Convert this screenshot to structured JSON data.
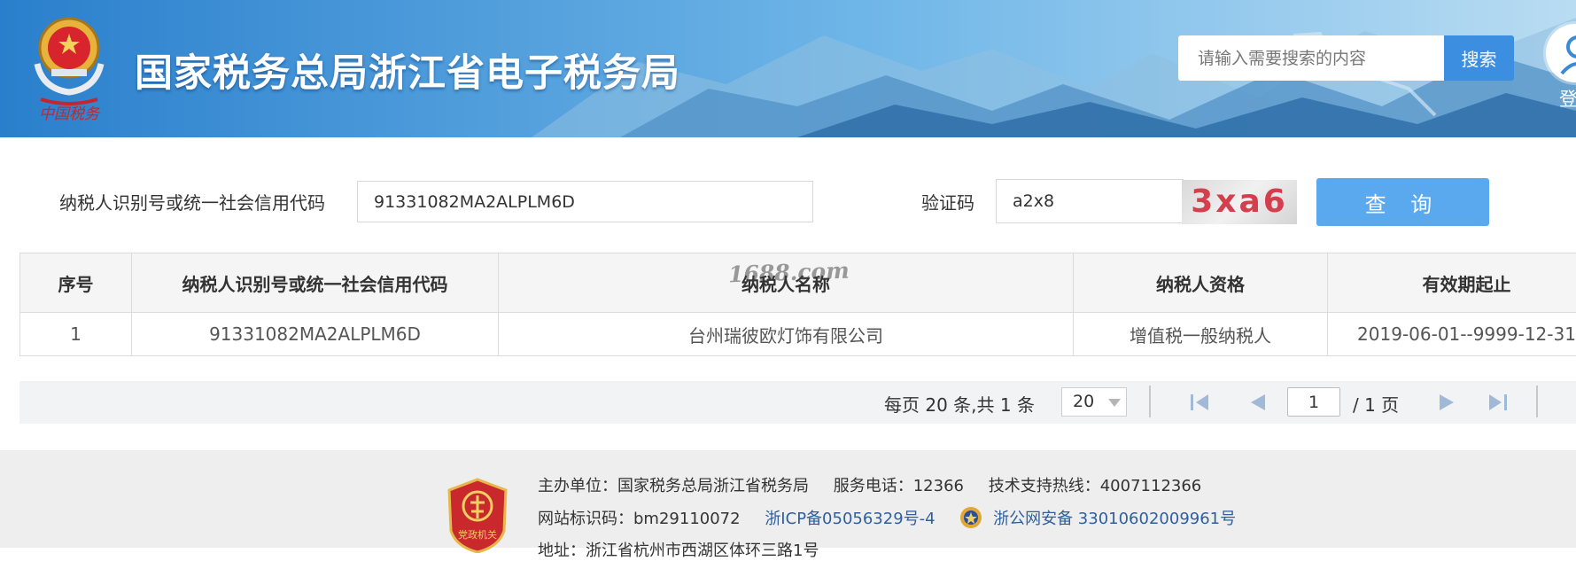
{
  "header": {
    "title": "国家税务总局浙江省电子税务局",
    "search_placeholder": "请输入需要搜索的内容",
    "search_button": "搜索",
    "login_label": "登",
    "emblem_text": "中国税务"
  },
  "query": {
    "taxpayer_id_label": "纳税人识别号或统一社会信用代码",
    "taxpayer_id_value": "91331082MA2ALPLM6D",
    "captcha_label": "验证码",
    "captcha_value": "a2x8",
    "captcha_image_text": "3xa6",
    "submit_button": "查 询"
  },
  "table": {
    "headers": [
      "序号",
      "纳税人识别号或统一社会信用代码",
      "纳税人名称",
      "纳税人资格",
      "有效期起止"
    ],
    "rows": [
      [
        "1",
        "91331082MA2ALPLM6D",
        "台州瑞彼欧灯饰有限公司",
        "增值税一般纳税人",
        "2019-06-01--9999-12-31"
      ]
    ],
    "watermark": "1688.com"
  },
  "pager": {
    "summary": "每页 20 条,共 1 条",
    "page_size": "20",
    "current_page": "1",
    "total_pages": "/ 1 页"
  },
  "footer": {
    "host": "主办单位：国家税务总局浙江省税务局",
    "phone": "服务电话：12366",
    "support": "技术支持热线：4007112366",
    "site_code": "网站标识码：bm29110072",
    "icp": "浙ICP备05056329号-4",
    "police": "浙公网安备 33010602009961号",
    "address": "地址：浙江省杭州市西湖区体环三路1号",
    "badge_text": "党政机关"
  }
}
